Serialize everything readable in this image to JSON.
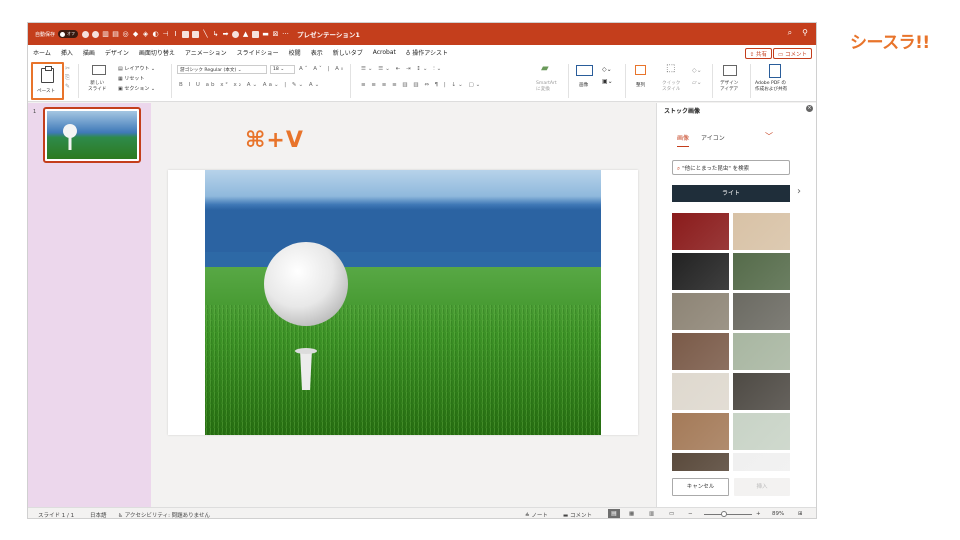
{
  "brand": {
    "logo_text": "シースラ!!"
  },
  "titlebar": {
    "autosave_label": "自動保存",
    "toggle_label": "オフ",
    "doc_title": "プレゼンテーション1"
  },
  "menu": {
    "items": [
      "ホーム",
      "挿入",
      "描画",
      "デザイン",
      "画面切り替え",
      "アニメーション",
      "スライドショー",
      "校閲",
      "表示",
      "新しいタブ",
      "Acrobat"
    ],
    "assist": "操作アシスト",
    "share": "共有",
    "comment": "コメント"
  },
  "ribbon": {
    "paste": "ペースト",
    "new_slide": "新しい\nスライド",
    "layout": "レイアウト",
    "reset": "リセット",
    "section": "セクション",
    "font_name": "游ゴシック Regular (本文)",
    "font_size": "18",
    "smartart": "SmartArt\nに変換",
    "picture": "画像",
    "arrange": "整列",
    "quick_style": "クイック\nスタイル",
    "design_ideas": "デザイン\nアイデア",
    "adobe_pdf": "Adobe PDF の\n作成および共有"
  },
  "thumbs": {
    "slide_number": "1"
  },
  "canvas": {
    "shortcut_text": "⌘+V"
  },
  "stock": {
    "title": "ストック画像",
    "tab_images": "画像",
    "tab_icons": "アイコン",
    "search_placeholder": "\"他にとまった昆虫\" を検索",
    "category": "ライト",
    "cancel": "キャンセル",
    "insert": "挿入",
    "thumbnail_colors": [
      "#8a1b1b",
      "#d8c2a6",
      "#222222",
      "#556b4a",
      "#8d8475",
      "#6b6a62",
      "#7a5a48",
      "#a8b6a1",
      "#ded8ce",
      "#4e4a44",
      "#a47a58",
      "#c8d3c6",
      "#5a4a3c",
      "#f0f0f0"
    ]
  },
  "status": {
    "slide_info": "スライド 1 / 1",
    "lang": "日本語",
    "accessibility": "アクセシビリティ: 問題ありません",
    "notes": "ノート",
    "comments": "コメント",
    "zoom": "89%"
  }
}
